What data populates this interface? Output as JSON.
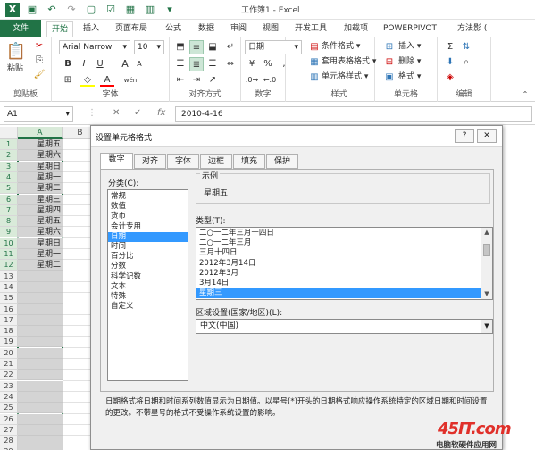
{
  "window": {
    "title": "工作簿1 - Excel"
  },
  "ribbon_tabs": [
    "文件",
    "开始",
    "插入",
    "页面布局",
    "公式",
    "数据",
    "审阅",
    "视图",
    "开发工具",
    "加载项",
    "POWERPIVOT",
    "方法影 ("
  ],
  "clipboard": {
    "paste": "粘贴",
    "label": "剪贴板"
  },
  "font": {
    "name": "Arial Narrow",
    "size": "10",
    "label": "字体",
    "bold": "B",
    "italic": "I",
    "underline": "U",
    "grow": "A",
    "shrink": "A",
    "color_letter": "A",
    "phonetic": "wén"
  },
  "alignment": {
    "label": "对齐方式"
  },
  "number": {
    "format": "日期",
    "label": "数字",
    "currency": "¥",
    "percent": "%",
    "comma": ","
  },
  "styles": {
    "conditional": "条件格式",
    "table": "套用表格格式",
    "cell": "单元格样式",
    "label": "样式"
  },
  "cells": {
    "insert": "插入",
    "delete": "删除",
    "format": "格式",
    "label": "单元格"
  },
  "editing": {
    "label": "编辑",
    "sum": "Σ"
  },
  "formula_bar": {
    "namebox": "A1",
    "cancel": "✕",
    "enter": "✓",
    "fx": "fx",
    "content": "2010-4-16"
  },
  "sheet": {
    "columns": [
      "A",
      "B"
    ],
    "rows": [
      "1",
      "2",
      "3",
      "4",
      "5",
      "6",
      "7",
      "8",
      "9",
      "10",
      "11",
      "12",
      "13",
      "14",
      "15",
      "16",
      "17",
      "18",
      "19",
      "20",
      "21",
      "22",
      "23",
      "24",
      "25",
      "26",
      "27",
      "28",
      "29"
    ],
    "cells_a": [
      "星期五",
      "星期六",
      "星期日",
      "星期一",
      "星期二",
      "星期三",
      "星期四",
      "星期五",
      "星期六",
      "星期日",
      "星期一",
      "星期二",
      "",
      "",
      "",
      "",
      "",
      "",
      "",
      "",
      "",
      "",
      "",
      "",
      "",
      "",
      "",
      "",
      ""
    ]
  },
  "dialog": {
    "title": "设置单元格格式",
    "help": "?",
    "close": "✕",
    "tabs": [
      "数字",
      "对齐",
      "字体",
      "边框",
      "填充",
      "保护"
    ],
    "category_label": "分类(C):",
    "categories": [
      "常规",
      "数值",
      "货币",
      "会计专用",
      "日期",
      "时间",
      "百分比",
      "分数",
      "科学记数",
      "文本",
      "特殊",
      "自定义"
    ],
    "selected_category": "日期",
    "sample_label": "示例",
    "sample_value": "星期五",
    "type_label": "类型(T):",
    "types": [
      "二○一二年三月十四日",
      "二○一二年三月",
      "三月十四日",
      "2012年3月14日",
      "2012年3月",
      "3月14日",
      "星期三"
    ],
    "selected_type": "星期三",
    "locale_label": "区域设置(国家/地区)(L):",
    "locale_value": "中文(中国)",
    "description": "日期格式将日期和时间系列数值显示为日期值。以星号(*)开头的日期格式响应操作系统特定的区域日期和时间设置的更改。不带星号的格式不受操作系统设置的影响。"
  },
  "watermark": {
    "logo": "45IT.com",
    "sub": "电脑软硬件应用网"
  },
  "colors": {
    "excel_green": "#217346",
    "selection_blue": "#3399ff",
    "logo_red": "#e0302a"
  }
}
